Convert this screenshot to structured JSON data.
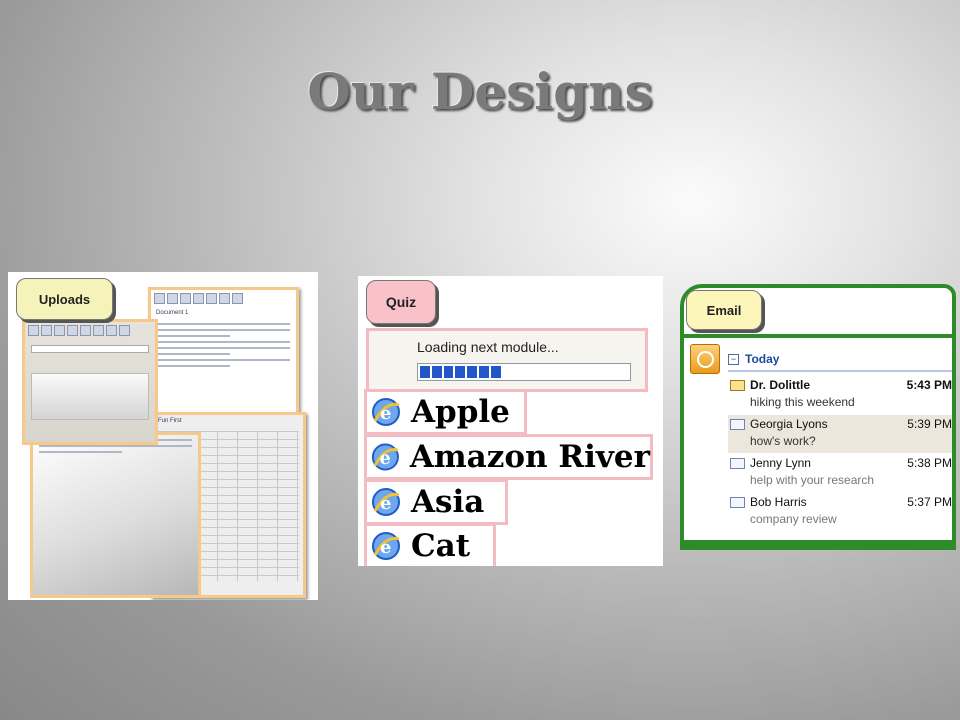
{
  "slide": {
    "title": "Our Designs"
  },
  "uploads": {
    "tab_label": "Uploads",
    "doc_title": "Document 1",
    "fun_first": "Fun First"
  },
  "quiz": {
    "tab_label": "Quiz",
    "loading_text": "Loading next module...",
    "progress_percent": 40,
    "answers": [
      "Apple",
      "Amazon River",
      "Asia",
      "Cat"
    ]
  },
  "email": {
    "tab_label": "Email",
    "group_label": "Today",
    "messages": [
      {
        "from": "Dr. Dolittle",
        "time": "5:43 PM",
        "subject": "hiking this weekend",
        "unread": true
      },
      {
        "from": "Georgia Lyons",
        "time": "5:39 PM",
        "subject": "how's work?",
        "unread": false
      },
      {
        "from": "Jenny Lynn",
        "time": "5:38 PM",
        "subject": "help with your research",
        "unread": false
      },
      {
        "from": "Bob Harris",
        "time": "5:37 PM",
        "subject": "company review",
        "unread": false
      }
    ]
  },
  "colors": {
    "uploads_tab": "#f6f3ba",
    "quiz_tab": "#f8c2c8",
    "email_border": "#2f8a2a",
    "progress": "#2257c9"
  }
}
